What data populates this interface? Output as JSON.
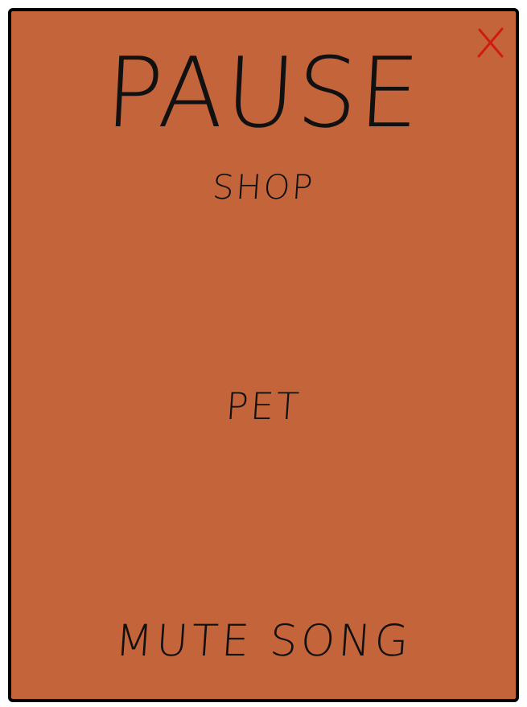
{
  "pause_menu": {
    "title": "PAUSE",
    "close_icon": "close-x-icon",
    "close_color": "#d11a12",
    "background_color": "#c4643a",
    "items": [
      {
        "label": "SHOP"
      },
      {
        "label": "PET"
      },
      {
        "label": "MUTE SONG"
      }
    ]
  }
}
